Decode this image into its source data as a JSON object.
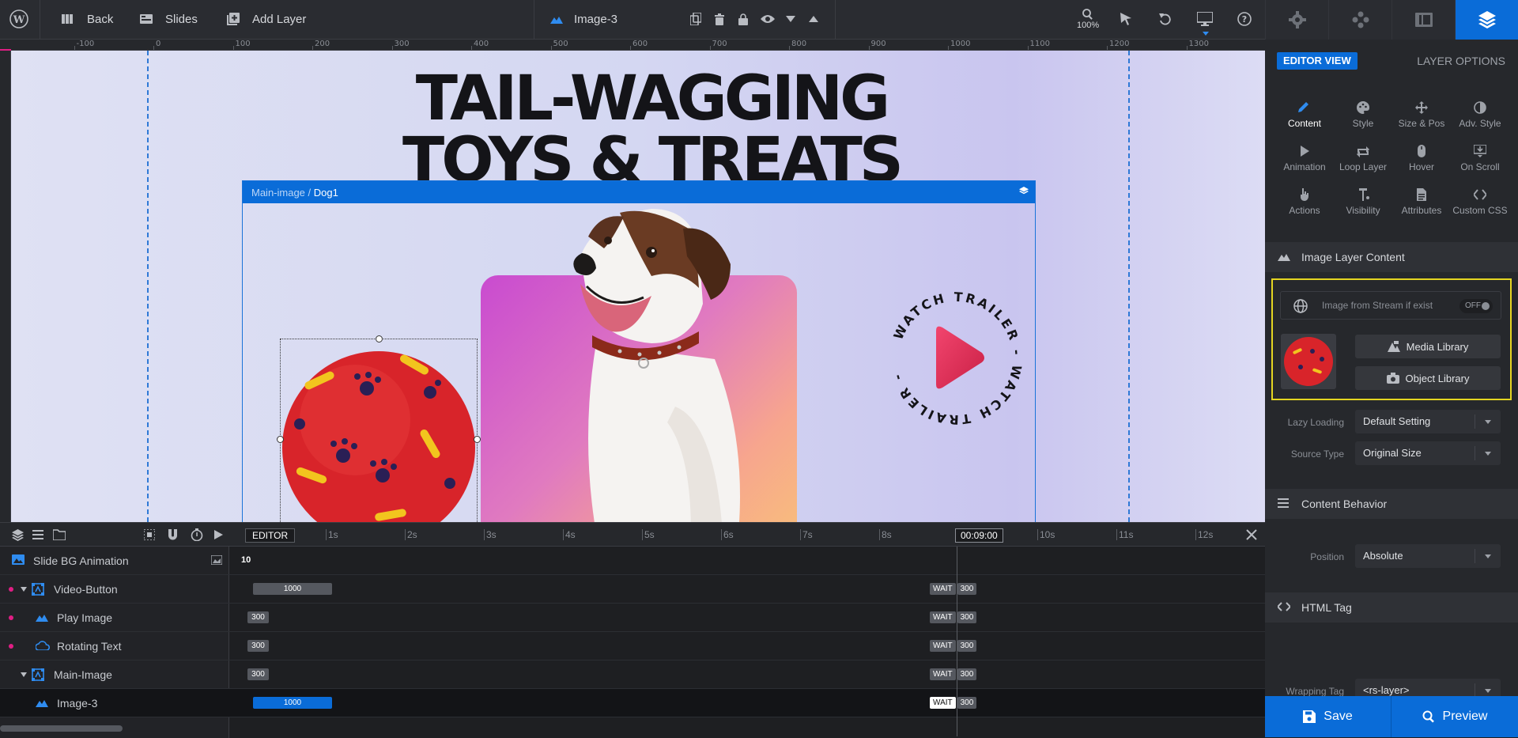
{
  "topbar": {
    "back_label": "Back",
    "slides_label": "Slides",
    "add_layer_label": "Add Layer",
    "layer_name": "Image-3",
    "zoom_label": "100%"
  },
  "ruler": {
    "top_labels": [
      "-100",
      "0",
      "100",
      "200",
      "300",
      "400",
      "500",
      "600",
      "700",
      "800",
      "900",
      "1000",
      "1100",
      "1200",
      "1300"
    ]
  },
  "canvas": {
    "headline_line1": "TAIL-WAGGING",
    "headline_line2": "TOYS & TREATS",
    "selection_path_parent": "Main-image",
    "selection_path_sep": " / ",
    "selection_path_child": "Dog1",
    "rotating_text": "WATCH TRAILER - WATCH TRAILER - WATCH TRAILER - "
  },
  "right_panel": {
    "editor_view_label": "EDITOR VIEW",
    "layer_options_label": "LAYER OPTIONS",
    "options": [
      {
        "label": "Content",
        "icon": "pencil-icon"
      },
      {
        "label": "Style",
        "icon": "palette-icon"
      },
      {
        "label": "Size & Pos",
        "icon": "move-icon"
      },
      {
        "label": "Adv. Style",
        "icon": "contrast-icon"
      },
      {
        "label": "Animation",
        "icon": "play-icon"
      },
      {
        "label": "Loop Layer",
        "icon": "loop-icon"
      },
      {
        "label": "Hover",
        "icon": "mouse-icon"
      },
      {
        "label": "On Scroll",
        "icon": "scroll-icon"
      },
      {
        "label": "Actions",
        "icon": "pointer-icon"
      },
      {
        "label": "Visibility",
        "icon": "visibility-icon"
      },
      {
        "label": "Attributes",
        "icon": "document-icon"
      },
      {
        "label": "Custom CSS",
        "icon": "code-icon"
      }
    ],
    "image_layer_content_title": "Image Layer Content",
    "stream_label": "Image from Stream if exist",
    "stream_toggle": "OFF",
    "media_library_label": "Media Library",
    "object_library_label": "Object Library",
    "lazy_loading_label": "Lazy Loading",
    "lazy_loading_value": "Default Setting",
    "source_type_label": "Source Type",
    "source_type_value": "Original Size",
    "content_behavior_title": "Content Behavior",
    "position_label": "Position",
    "position_value": "Absolute",
    "html_tag_title": "HTML Tag",
    "wrapping_tag_label": "Wrapping Tag",
    "wrapping_tag_value": "<rs-layer>",
    "save_label": "Save",
    "preview_label": "Preview"
  },
  "timeline": {
    "editor_label": "EDITOR",
    "time_marker": "00:09:00",
    "ticks": [
      "1s",
      "2s",
      "3s",
      "4s",
      "5s",
      "6s",
      "7s",
      "8s",
      "10s",
      "11s",
      "12s"
    ],
    "rows": [
      {
        "label": "Slide BG Animation",
        "start_value": "10"
      },
      {
        "label": "Video-Button",
        "bar": "1000",
        "wait": "WAIT",
        "end": "300"
      },
      {
        "label": "Play Image",
        "bar": "300",
        "wait": "WAIT",
        "end": "300"
      },
      {
        "label": "Rotating Text",
        "bar": "300",
        "wait": "WAIT",
        "end": "300"
      },
      {
        "label": "Main-Image",
        "bar": "300",
        "wait": "WAIT",
        "end": "300"
      },
      {
        "label": "Image-3",
        "bar": "1000",
        "wait": "WAIT",
        "end": "300"
      }
    ]
  }
}
